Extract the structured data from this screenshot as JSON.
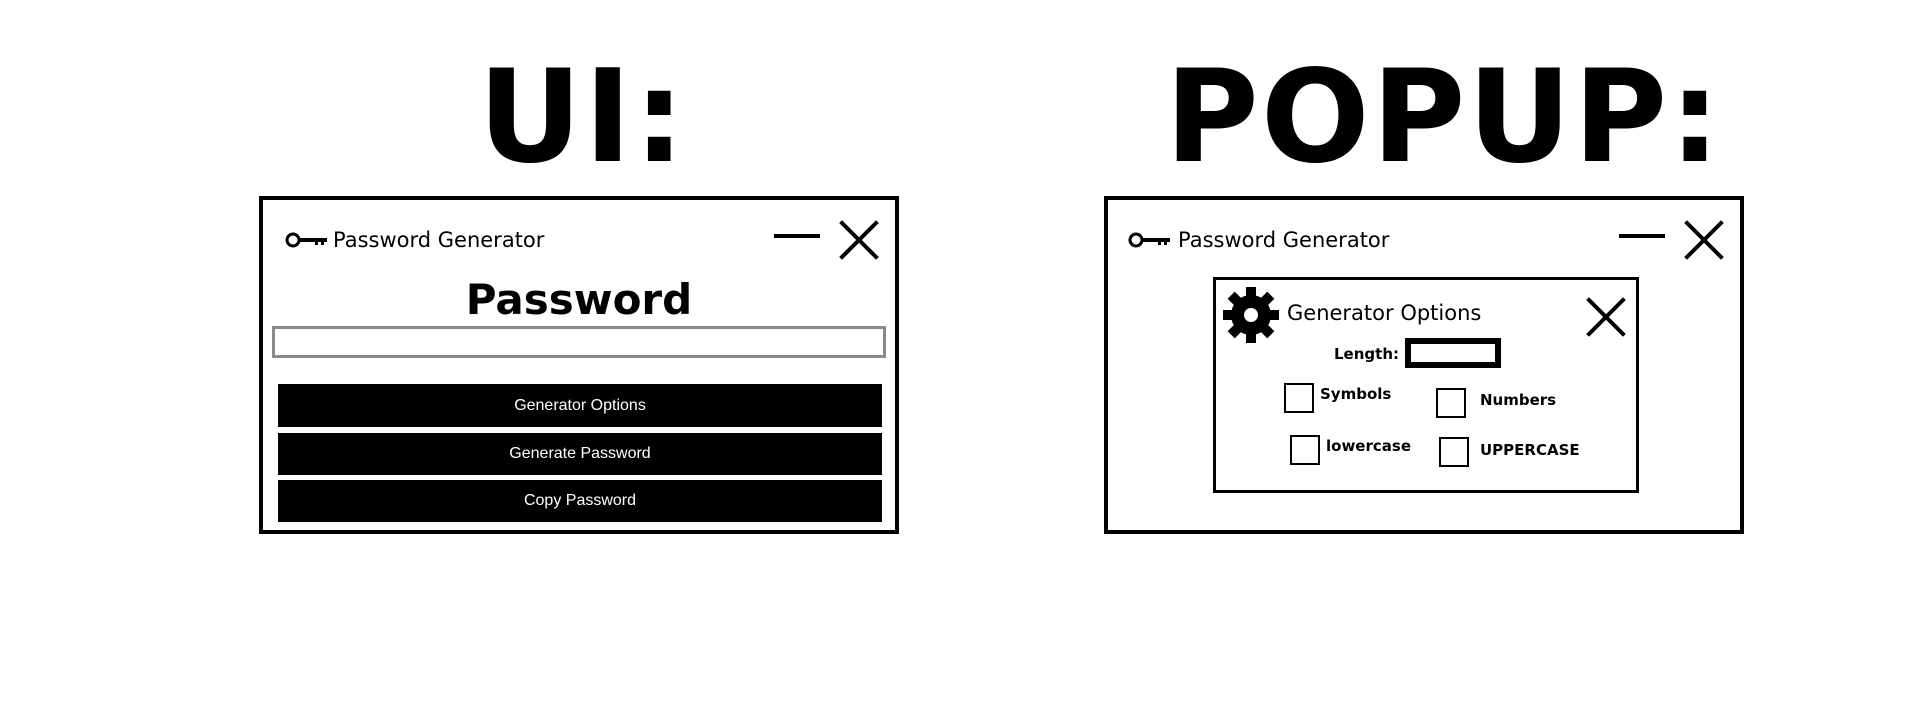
{
  "headings": {
    "ui": "UI:",
    "popup": "POPUP:"
  },
  "main_window": {
    "title": "Password Generator",
    "title_icon": "key-icon",
    "password_label": "Password",
    "password_value": "",
    "buttons": {
      "options": "Generator Options",
      "generate": "Generate Password",
      "copy": "Copy Password"
    }
  },
  "popup_window": {
    "title": "Password Generator",
    "title_icon": "key-icon",
    "dialog": {
      "title": "Generator Options",
      "icon": "gear-icon",
      "length_label": "Length:",
      "length_value": "",
      "options": {
        "symbols": "Symbols",
        "numbers": "Numbers",
        "lowercase": "lowercase",
        "uppercase": "UPPERCASE"
      }
    }
  },
  "colors": {
    "border": "#000000",
    "button_bg": "#000000",
    "button_text": "#ffffff",
    "input_border": "#8a8a8a"
  }
}
